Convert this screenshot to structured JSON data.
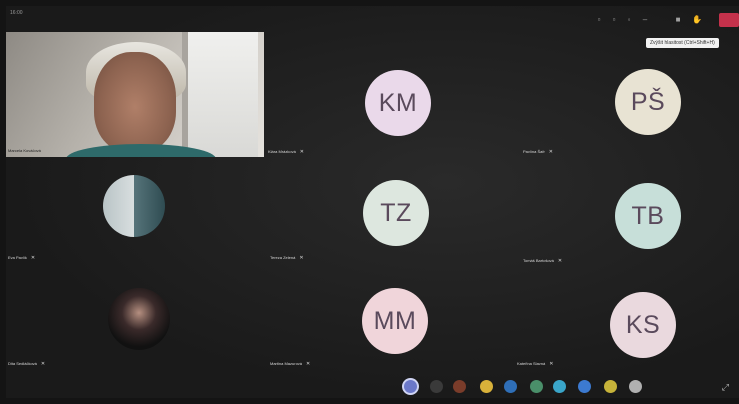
{
  "window": {
    "top_label": "16:00"
  },
  "toolbar": {
    "icons": [
      "participants-icon",
      "chat-icon",
      "more-icon",
      "camera-icon",
      "raise-hand-icon"
    ],
    "tooltip": "Zvýšit hlasitost (Ctrl+Shift+H)"
  },
  "participants": [
    {
      "name": "Marcela Kováčová",
      "type": "video"
    },
    {
      "name": "Klára Mrázková",
      "initials": "KM",
      "color": "#ead9ea"
    },
    {
      "name": "Pavlína Šafr",
      "initials": "PŠ",
      "color": "#e8e3d3"
    },
    {
      "name": "Eva Pavlík",
      "type": "photo"
    },
    {
      "name": "Tereza Zelená",
      "initials": "TZ",
      "color": "#dde7df"
    },
    {
      "name": "Tomáš Bartošová",
      "initials": "TB",
      "color": "#c7dfd9"
    },
    {
      "name": "Dita Sedláčková",
      "type": "photo"
    },
    {
      "name": "Martina Mazurová",
      "initials": "MM",
      "color": "#f0d5da"
    },
    {
      "name": "Kateřina Slavná",
      "initials": "KS",
      "color": "#ead9de"
    }
  ],
  "dock_icons": [
    "teams-icon",
    "browser-icon",
    "app-icon",
    "chrome-icon",
    "files-icon",
    "photos-icon",
    "edge-icon",
    "store-icon",
    "mail-icon",
    "settings-icon"
  ],
  "colors": {
    "leave": "#c4314b",
    "tooltip_bg": "#f2f2f2"
  }
}
